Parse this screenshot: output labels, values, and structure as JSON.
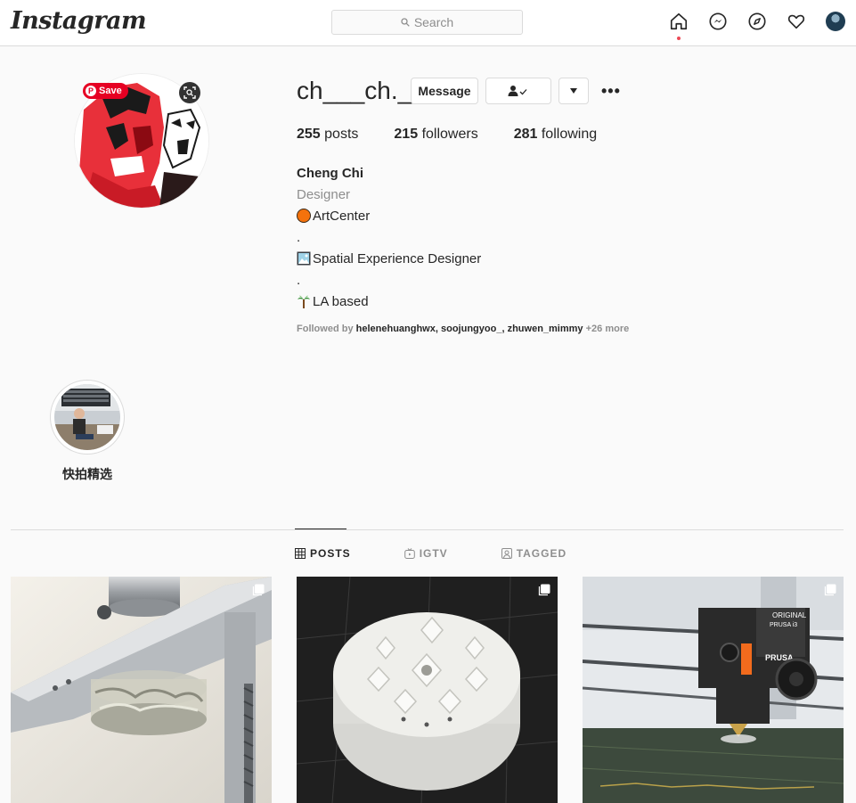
{
  "nav": {
    "logo": "Instagram",
    "search_placeholder": "Search",
    "icons": [
      "home-icon",
      "messenger-icon",
      "explore-icon",
      "activity-heart-icon",
      "profile-avatar"
    ]
  },
  "profile": {
    "save_label": "Save",
    "username": "ch___ch._",
    "message_label": "Message",
    "stats": {
      "posts_count": "255",
      "posts_label": "posts",
      "followers_count": "215",
      "followers_label": "followers",
      "following_count": "281",
      "following_label": "following"
    },
    "bio": {
      "name": "Cheng Chi",
      "category": "Designer",
      "line1": "ArtCenter",
      "sep1": ".",
      "line2": "Spatial Experience Designer",
      "sep2": ".",
      "line3": "LA based"
    },
    "followed_by": {
      "prefix": "Followed by ",
      "users": "helenehuanghwx",
      "comma1": ", ",
      "user2": "soojungyoo_",
      "comma2": ", ",
      "user3": "zhuwen_mimmy",
      "more": " +26 more"
    }
  },
  "highlights": [
    {
      "label": "快拍精选"
    }
  ],
  "tabs": [
    {
      "label": "POSTS",
      "active": true
    },
    {
      "label": "IGTV",
      "active": false
    },
    {
      "label": "TAGGED",
      "active": false
    }
  ],
  "colors": {
    "accent": "#ed4956",
    "pinterest": "#e60023",
    "text": "#262626",
    "muted": "#8e8e8e"
  }
}
